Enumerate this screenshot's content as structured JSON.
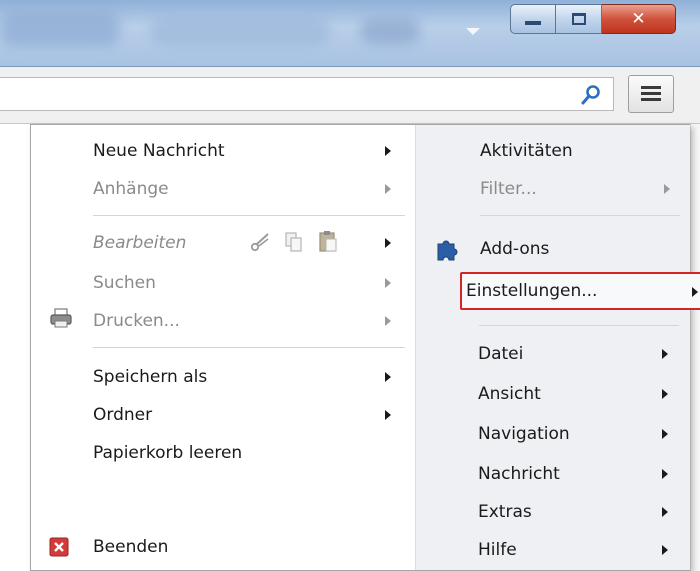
{
  "window": {
    "dropdown_icon": "triangle-down-icon",
    "controls": [
      {
        "name": "minimize",
        "icon": "minimize-icon"
      },
      {
        "name": "maximize",
        "icon": "maximize-icon"
      },
      {
        "name": "close",
        "icon": "close-icon",
        "color": "#d0513b"
      }
    ]
  },
  "toolbar": {
    "search_icon": "search-icon",
    "menu_icon": "hamburger-icon"
  },
  "menu": {
    "left": [
      {
        "label": "Neue Nachricht",
        "enabled": true,
        "submenu": true
      },
      {
        "label": "Anhänge",
        "enabled": false,
        "submenu": true
      },
      {
        "label": "Bearbeiten",
        "enabled": false,
        "submenu": true,
        "icons": [
          "cut-icon",
          "copy-icon",
          "paste-icon"
        ]
      },
      {
        "label": "Suchen",
        "enabled": false,
        "submenu": true
      },
      {
        "label": "Drucken...",
        "enabled": false,
        "submenu": true,
        "icon": "printer-icon"
      },
      {
        "label": "Speichern als",
        "enabled": true,
        "submenu": true
      },
      {
        "label": "Ordner",
        "enabled": true,
        "submenu": true
      },
      {
        "label": "Papierkorb leeren",
        "enabled": true,
        "submenu": false
      },
      {
        "label": "Beenden",
        "enabled": true,
        "submenu": false,
        "icon": "exit-icon"
      }
    ],
    "right": [
      {
        "label": "Aktivitäten",
        "enabled": true,
        "submenu": false
      },
      {
        "label": "Filter...",
        "enabled": false,
        "submenu": true
      },
      {
        "label": "Add-ons",
        "enabled": true,
        "submenu": false,
        "icon": "puzzle-icon"
      },
      {
        "label": "Einstellungen...",
        "enabled": true,
        "submenu": true,
        "highlighted": true
      },
      {
        "label": "Datei",
        "enabled": true,
        "submenu": true
      },
      {
        "label": "Ansicht",
        "enabled": true,
        "submenu": true
      },
      {
        "label": "Navigation",
        "enabled": true,
        "submenu": true
      },
      {
        "label": "Nachricht",
        "enabled": true,
        "submenu": true
      },
      {
        "label": "Extras",
        "enabled": true,
        "submenu": true
      },
      {
        "label": "Hilfe",
        "enabled": true,
        "submenu": true
      }
    ]
  },
  "colors": {
    "titlebar": "#a8c2e2",
    "highlight_border": "#d42424",
    "puzzle": "#2b5ea6",
    "exit": "#d33a3a"
  }
}
